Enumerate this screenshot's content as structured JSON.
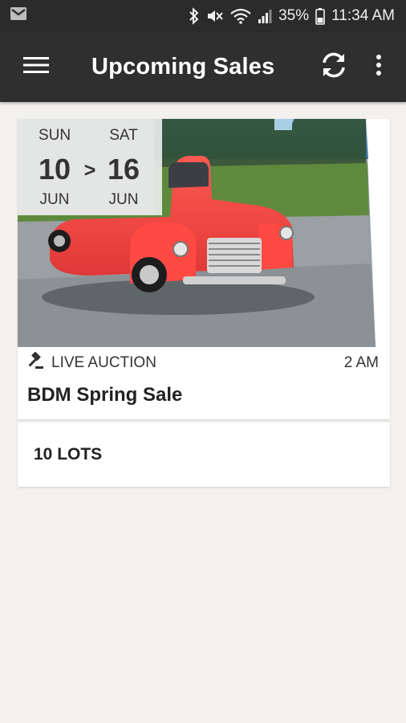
{
  "status_bar": {
    "battery": "35%",
    "time": "11:34 AM"
  },
  "app_bar": {
    "title": "Upcoming Sales",
    "icons": [
      "menu-icon",
      "refresh-icon",
      "more-vert-icon"
    ]
  },
  "sale": {
    "start_day": "SUN",
    "start_date": "10",
    "start_month": "JUN",
    "separator": ">",
    "end_day": "SAT",
    "end_date": "16",
    "end_month": "JUN",
    "type": "LIVE AUCTION",
    "time": "2 AM",
    "name": "BDM Spring Sale",
    "lots": "10 LOTS",
    "image_subject": "red vintage pickup truck"
  }
}
